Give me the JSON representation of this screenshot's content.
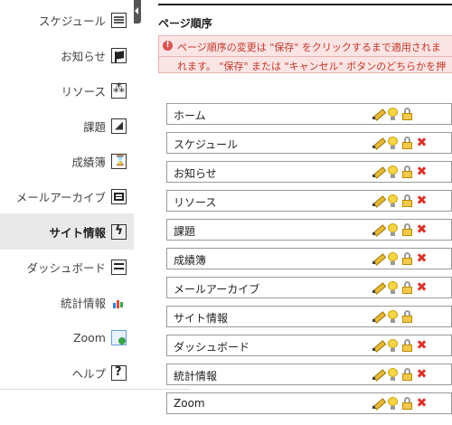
{
  "sidebar": {
    "items": [
      {
        "label": "スケジュール",
        "icon": "schedule-icon",
        "active": false
      },
      {
        "label": "お知らせ",
        "icon": "announcement-icon",
        "active": false
      },
      {
        "label": "リソース",
        "icon": "resources-icon",
        "active": false
      },
      {
        "label": "課題",
        "icon": "assignment-icon",
        "active": false
      },
      {
        "label": "成績簿",
        "icon": "gradebook-icon",
        "active": false
      },
      {
        "label": "メールアーカイブ",
        "icon": "mail-archive-icon",
        "active": false
      },
      {
        "label": "サイト情報",
        "icon": "site-info-icon",
        "active": true
      },
      {
        "label": "ダッシュボード",
        "icon": "dashboard-icon",
        "active": false
      },
      {
        "label": "統計情報",
        "icon": "statistics-icon",
        "active": false
      },
      {
        "label": "Zoom",
        "icon": "zoom-icon",
        "active": false
      },
      {
        "label": "ヘルプ",
        "icon": "help-icon",
        "active": false
      }
    ]
  },
  "main": {
    "title": "ページ順序",
    "alert_line1": "ページ順序の変更は \"保存\" をクリックするまで適用されま",
    "alert_line2": "れます。 \"保存\" または \"キャンセル\" ボタンのどちらかを押",
    "pages": [
      {
        "name": "ホーム",
        "removable": false
      },
      {
        "name": "スケジュール",
        "removable": true
      },
      {
        "name": "お知らせ",
        "removable": true
      },
      {
        "name": "リソース",
        "removable": true
      },
      {
        "name": "課題",
        "removable": true
      },
      {
        "name": "成績簿",
        "removable": true
      },
      {
        "name": "メールアーカイブ",
        "removable": true
      },
      {
        "name": "サイト情報",
        "removable": false
      },
      {
        "name": "ダッシュボード",
        "removable": true
      },
      {
        "name": "統計情報",
        "removable": true
      },
      {
        "name": "Zoom",
        "removable": true
      }
    ]
  },
  "colors": {
    "alert_bg": "#fbe4e4",
    "alert_text": "#c0392b",
    "active_nav_bg": "#e9e9e9",
    "delete_red": "#d9342b"
  }
}
